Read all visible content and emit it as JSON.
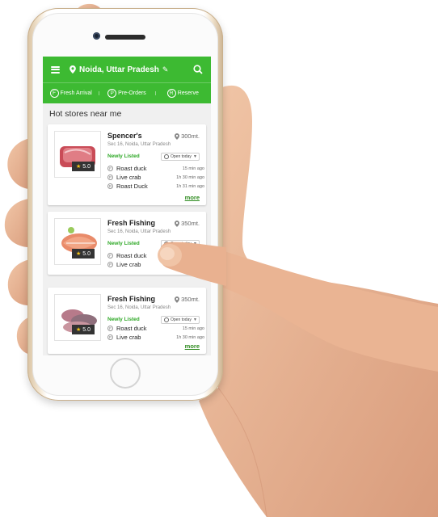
{
  "colors": {
    "brand": "#3dba32",
    "link": "#2e8b1f",
    "newly": "#2ea826",
    "star": "#f5c518"
  },
  "header": {
    "location": "Noida, Uttar Pradesh",
    "icons": [
      "menu-icon",
      "location-pin-icon",
      "pencil-icon",
      "search-icon"
    ]
  },
  "tabs": [
    {
      "letter": "F",
      "label": "Fresh Arrival"
    },
    {
      "letter": "P",
      "label": "Pre-Orders"
    },
    {
      "letter": "R",
      "label": "Reserve"
    }
  ],
  "section_title": "Hot stores near me",
  "stores": [
    {
      "name": "Spencer's",
      "distance": "300mt.",
      "address": "Sec 16, Noida, Uttar Pradesh",
      "newly": "Newly Listed",
      "open": "Open today",
      "rating": "5.0",
      "more": "more",
      "items": [
        {
          "badge": "F",
          "name": "Roast duck",
          "time": "15 min ago"
        },
        {
          "badge": "P",
          "name": "Live crab",
          "time": "1h 30 min ago"
        },
        {
          "badge": "R",
          "name": "Roast Duck",
          "time": "1h 31 min ago"
        }
      ]
    },
    {
      "name": "Fresh Fishing",
      "distance": "350mt.",
      "address": "Sec 16, Noida, Uttar Pradesh",
      "newly": "Newly Listed",
      "open": "Open today",
      "rating": "5.0",
      "items": [
        {
          "badge": "F",
          "name": "Roast duck",
          "time": ""
        },
        {
          "badge": "P",
          "name": "Live crab",
          "time": ""
        }
      ]
    },
    {
      "name": "Fresh Fishing",
      "distance": "350mt.",
      "address": "Sec 16, Noida, Uttar Pradesh",
      "newly": "Newly Listed",
      "open": "Open today",
      "rating": "5.0",
      "more": "more",
      "items": [
        {
          "badge": "F",
          "name": "Roast duck",
          "time": "15 min ago"
        },
        {
          "badge": "P",
          "name": "Live crab",
          "time": "1h 30 min ago"
        }
      ]
    }
  ]
}
